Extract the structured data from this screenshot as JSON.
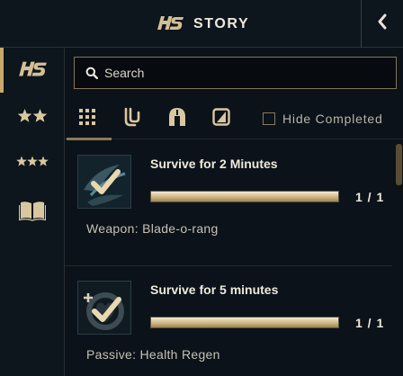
{
  "header": {
    "title": "STORY",
    "logo_icon": "hs-logo-icon",
    "collapse_icon": "chevron-left-icon"
  },
  "sidebar": {
    "items": [
      {
        "name": "hs-logo-icon",
        "active": true
      },
      {
        "name": "two-stars-icon",
        "active": false
      },
      {
        "name": "three-stars-icon",
        "active": false
      },
      {
        "name": "book-icon",
        "active": false
      }
    ]
  },
  "search": {
    "placeholder": "Search",
    "value": ""
  },
  "filters": {
    "tabs": [
      {
        "name": "grid-icon",
        "active": true
      },
      {
        "name": "clip-icon",
        "active": false
      },
      {
        "name": "helmet-icon",
        "active": false
      },
      {
        "name": "slash-box-icon",
        "active": false
      }
    ],
    "hide_completed_label": "Hide Completed",
    "hide_completed_checked": false
  },
  "quests": [
    {
      "title": "Survive for 2 Minutes",
      "progress_text": "1 / 1",
      "progress": 1.0,
      "reward": "Weapon: Blade-o-rang",
      "icon": "boomerang-check-icon"
    },
    {
      "title": "Survive for 5 minutes",
      "progress_text": "1 / 1",
      "progress": 1.0,
      "reward": "Passive: Health Regen",
      "icon": "heart-check-icon"
    }
  ],
  "colors": {
    "accent_gold": "#c8a969",
    "background": "#0b1219",
    "panel": "#0d151d",
    "text": "#efe9dc"
  }
}
